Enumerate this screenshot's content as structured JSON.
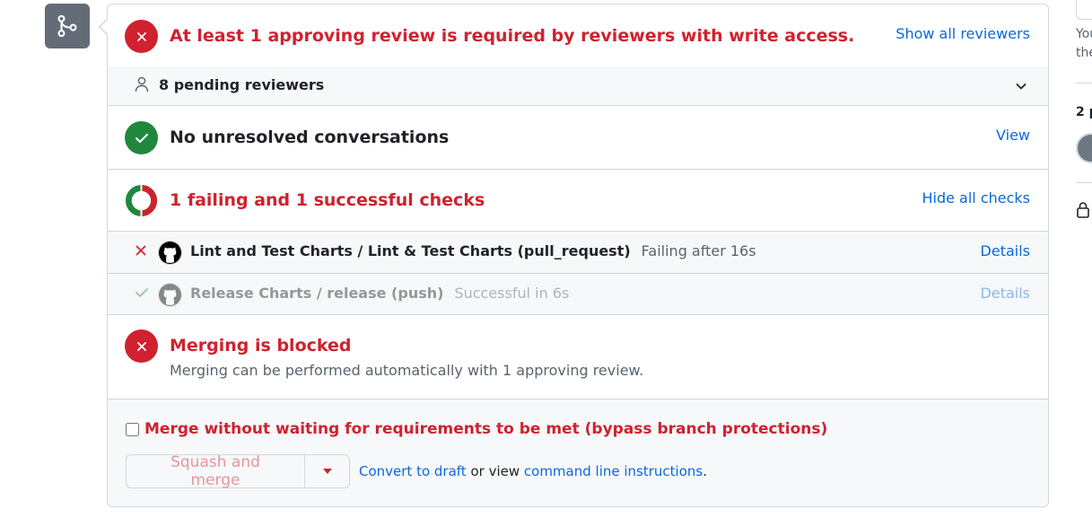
{
  "reviews": {
    "title": "At least 1 approving review is required by reviewers with write access.",
    "show_all_link": "Show all reviewers",
    "pending_label": "8 pending reviewers"
  },
  "conversations": {
    "title": "No unresolved conversations",
    "view_link": "View"
  },
  "checks": {
    "title": "1 failing and 1 successful checks",
    "hide_link": "Hide all checks",
    "items": [
      {
        "name": "Lint and Test Charts / Lint & Test Charts (pull_request)",
        "status": "Failing after 16s",
        "details": "Details",
        "result": "failure"
      },
      {
        "name": "Release Charts / release (push)",
        "status": "Successful in 6s",
        "details": "Details",
        "result": "success"
      }
    ]
  },
  "merge": {
    "blocked_title": "Merging is blocked",
    "blocked_sub": "Merging can be performed automatically with 1 approving review.",
    "bypass_label": "Merge without waiting for requirements to be met (bypass branch protections)",
    "bypass_checked": false,
    "button_label": "Squash and merge",
    "convert_link": "Convert to draft",
    "or_view": " or view ",
    "cli_link": "command line instructions",
    "period": "."
  },
  "sidebar": {
    "line1": "You",
    "line2": "the",
    "participants": "2 p"
  },
  "colors": {
    "danger": "#cf222e",
    "success": "#1f883d",
    "accent": "#0969da",
    "muted_bg": "#f6f8fa",
    "border": "#d0d7de"
  }
}
